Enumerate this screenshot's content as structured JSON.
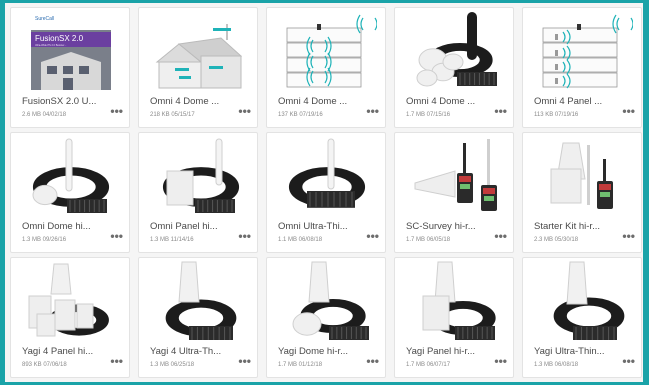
{
  "files": [
    {
      "title": "FusionSX 2.0 U...",
      "meta": "2.6 MB 04/02/18",
      "thumb": "cover-fusionsx",
      "cover": {
        "brand": "SureCall",
        "product": "FusionSX 2.0",
        "tagline": "Ultra-Wide PS 2.0 Booster..."
      }
    },
    {
      "title": "Omni 4 Dome ...",
      "meta": "218 KB 05/15/17",
      "thumb": "house-diagram"
    },
    {
      "title": "Omni 4 Dome ...",
      "meta": "137 KB 07/19/16",
      "thumb": "building-diagram"
    },
    {
      "title": "Omni 4 Dome ...",
      "meta": "1.7 MB 07/15/16",
      "thumb": "kit-domes"
    },
    {
      "title": "Omni 4 Panel ...",
      "meta": "113 KB 07/19/16",
      "thumb": "building-panels"
    },
    {
      "title": "Omni Dome hi...",
      "meta": "1.3 MB 09/26/16",
      "thumb": "kit-omni-dome"
    },
    {
      "title": "Omni Panel hi...",
      "meta": "1.3 MB 11/14/16",
      "thumb": "kit-omni-panel"
    },
    {
      "title": "Omni Ultra-Thi...",
      "meta": "1.1 MB 06/08/18",
      "thumb": "kit-omni-ultra"
    },
    {
      "title": "SC-Survey hi-r...",
      "meta": "1.7 MB 06/05/18",
      "thumb": "survey-kit"
    },
    {
      "title": "Starter Kit hi-r...",
      "meta": "2.3 MB 05/30/18",
      "thumb": "starter-kit"
    },
    {
      "title": "Yagi 4 Panel hi...",
      "meta": "893 KB 07/06/18",
      "thumb": "yagi-panels"
    },
    {
      "title": "Yagi 4 Ultra-Th...",
      "meta": "1.3 MB 06/25/18",
      "thumb": "yagi-ultra4"
    },
    {
      "title": "Yagi Dome hi-r...",
      "meta": "1.7 MB 01/12/18",
      "thumb": "yagi-dome"
    },
    {
      "title": "Yagi Panel hi-r...",
      "meta": "1.7 MB 06/07/17",
      "thumb": "yagi-panel"
    },
    {
      "title": "Yagi Ultra-Thin...",
      "meta": "1.3 MB 06/08/18",
      "thumb": "yagi-ultra"
    }
  ],
  "more_label": "•••",
  "colors": {
    "background": "#1aa3a8",
    "cover_purple": "#6b3fa0",
    "signal": "#1fb3b8"
  }
}
